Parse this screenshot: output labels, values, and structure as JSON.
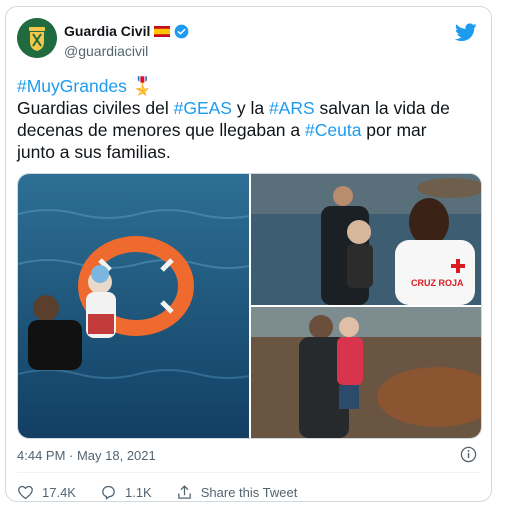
{
  "author": {
    "display_name": "Guardia Civil",
    "handle": "@guardiacivil"
  },
  "tweet": {
    "lines": [
      [
        {
          "text": "#MuyGrandes",
          "tag": true
        },
        {
          "text": " 🎖️",
          "tag": false
        }
      ],
      [
        {
          "text": "Guardias civiles del ",
          "tag": false
        },
        {
          "text": "#GEAS",
          "tag": true
        },
        {
          "text": " y la ",
          "tag": false
        },
        {
          "text": "#ARS",
          "tag": true
        },
        {
          "text": " salvan la vida de",
          "tag": false
        }
      ],
      [
        {
          "text": "decenas de menores que llegaban  a ",
          "tag": false
        },
        {
          "text": "#Ceuta",
          "tag": true
        },
        {
          "text": " por mar",
          "tag": false
        }
      ],
      [
        {
          "text": "junto a sus familias.",
          "tag": false
        }
      ]
    ]
  },
  "media": {
    "photo_3_overlay_text": "CRUZ ROJA"
  },
  "timestamp": "4:44 PM · May 18, 2021",
  "actions": {
    "likes": "17.4K",
    "replies": "1.1K",
    "share_label": "Share this Tweet"
  },
  "colors": {
    "link": "#1d9bf0",
    "muted": "#536471",
    "border": "#cfd9de",
    "like_red": "#f91880"
  }
}
